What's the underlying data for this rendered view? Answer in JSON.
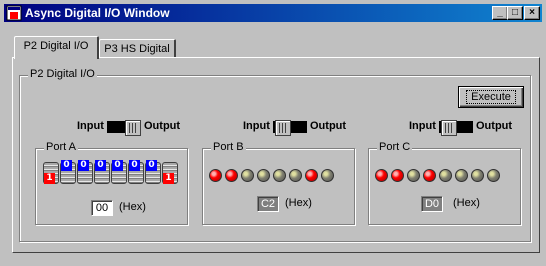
{
  "window": {
    "title": "Async Digital I/O Window",
    "controls": {
      "minimize": "_",
      "maximize": "□",
      "close": "×"
    },
    "icon": "app-window-icon"
  },
  "tabs": [
    {
      "label": "P2 Digital I/O",
      "selected": true
    },
    {
      "label": "P3 HS Digital",
      "selected": false
    }
  ],
  "panel": {
    "group_label": "P2  Digital I/O",
    "execute_label": "Execute",
    "ports": [
      {
        "name": "Port A",
        "toggle": {
          "input_label": "Input",
          "output_label": "Output",
          "mode": "Output"
        },
        "bits": [
          "1",
          "0",
          "0",
          "0",
          "0",
          "0",
          "0",
          "1"
        ],
        "hex_value": "00",
        "hex_unit": "(Hex)"
      },
      {
        "name": "Port B",
        "toggle": {
          "input_label": "Input",
          "output_label": "Output",
          "mode": "Input"
        },
        "leds": [
          true,
          true,
          false,
          false,
          false,
          false,
          true,
          false
        ],
        "hex_value": "C2",
        "hex_unit": "(Hex)"
      },
      {
        "name": "Port C",
        "toggle": {
          "input_label": "Input",
          "output_label": "Output",
          "mode": "Input"
        },
        "leds": [
          true,
          true,
          false,
          true,
          false,
          false,
          false,
          false
        ],
        "hex_value": "D0",
        "hex_unit": "(Hex)"
      }
    ]
  },
  "colors": {
    "face": "#c0c0c0",
    "title_start": "#000080",
    "title_end": "#1084d0",
    "led_on": "#ff0000",
    "led_off": "#808070",
    "bit_zero": "#0000ff",
    "bit_one": "#ff0000"
  }
}
